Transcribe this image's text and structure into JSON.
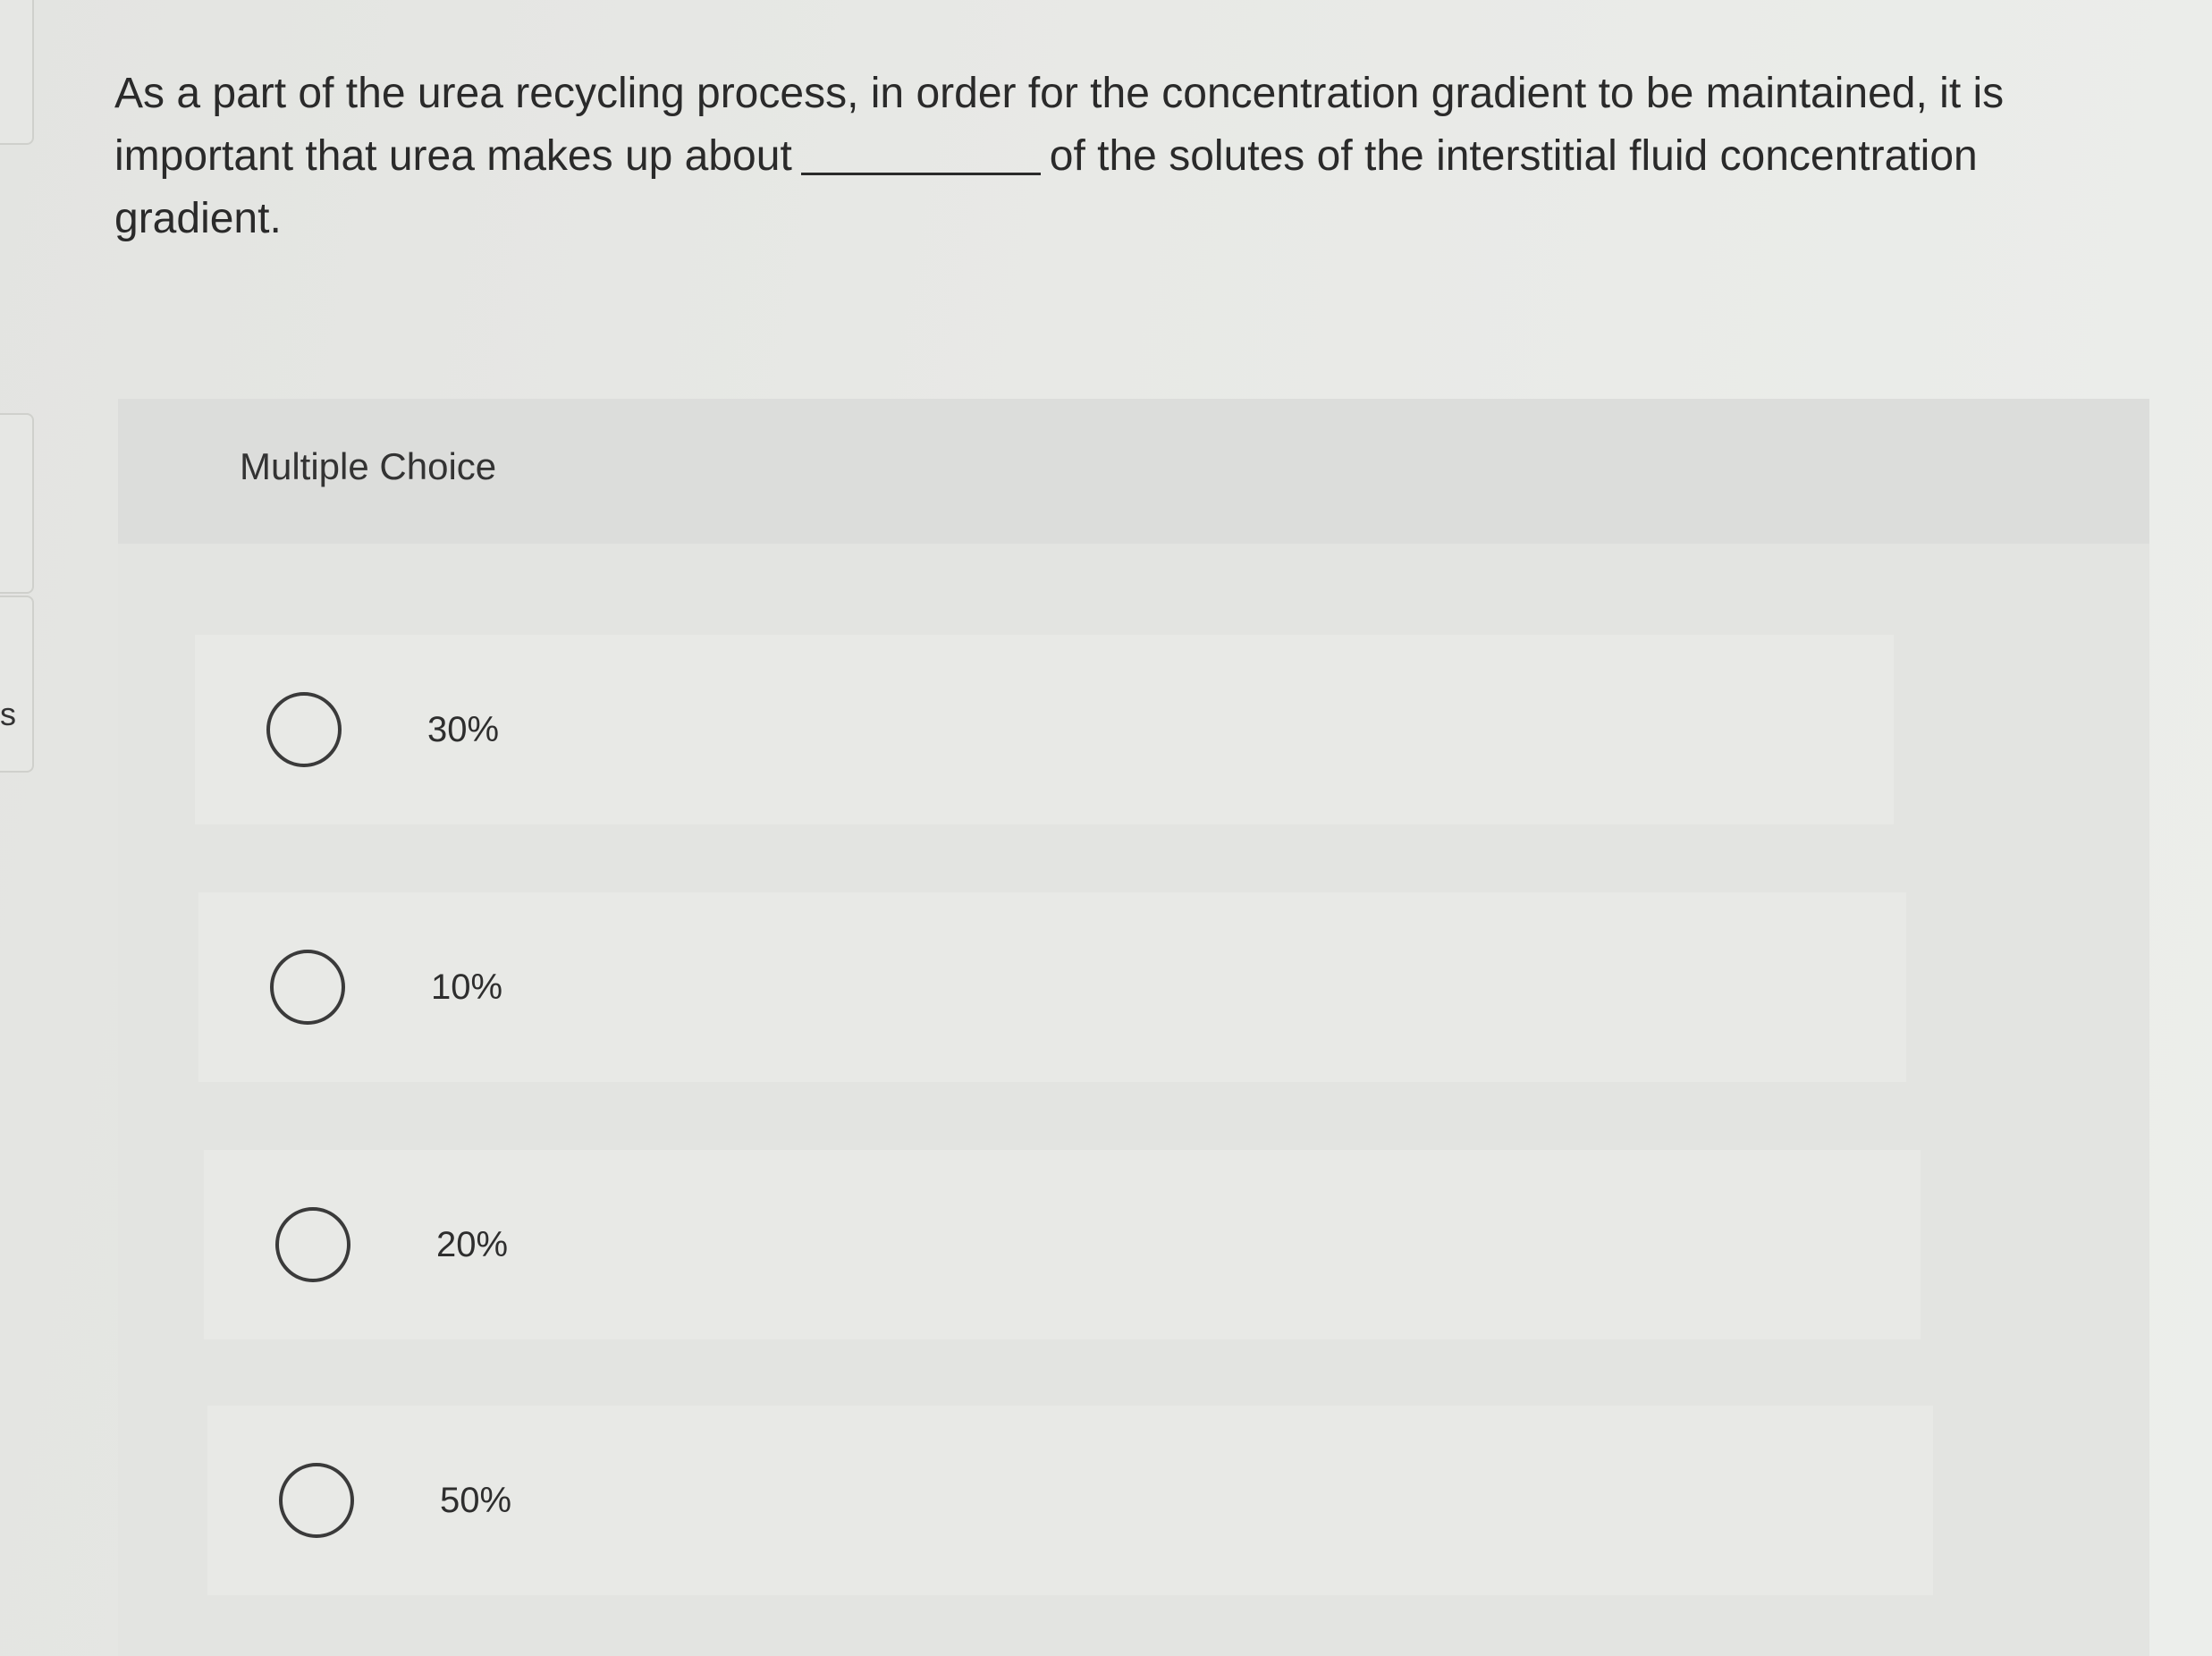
{
  "question": {
    "text_before": "As a part of the urea recycling process, in order for the concentration gradient to be maintained, it is important that urea makes up about",
    "text_after": "of the solutes of the interstitial fluid concentration gradient."
  },
  "multiple_choice": {
    "label": "Multiple Choice",
    "options": [
      {
        "label": "30%"
      },
      {
        "label": "10%"
      },
      {
        "label": "20%"
      },
      {
        "label": "50%"
      }
    ]
  },
  "left_edge": {
    "letter": "s"
  }
}
